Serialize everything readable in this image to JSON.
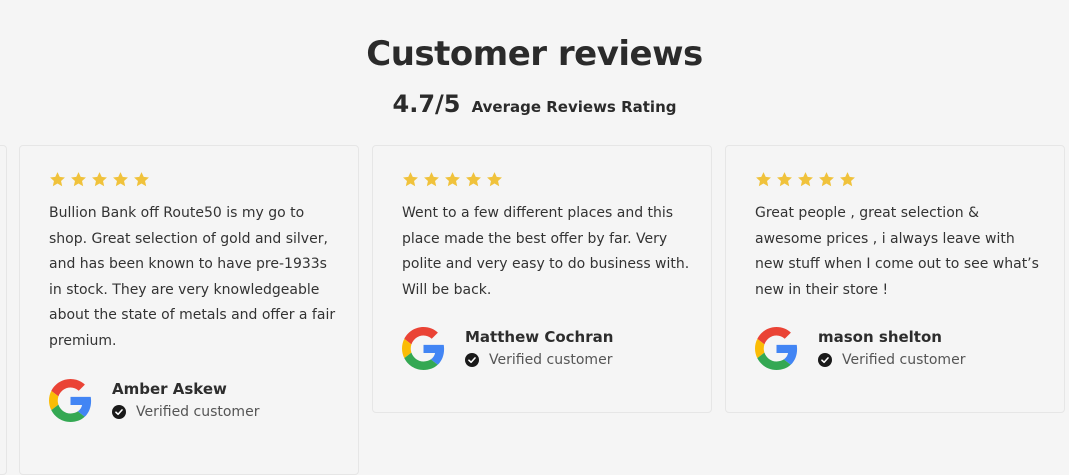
{
  "header": {
    "title": "Customer reviews",
    "rating_value": "4.7/5",
    "rating_label": "Average Reviews Rating"
  },
  "colors": {
    "star": "#f0c23b",
    "background": "#f5f5f5"
  },
  "reviews": [
    {
      "stars": 5,
      "text": "Bullion Bank off Route50 is my go to shop. Great selection of gold and silver, and has been known to have pre-1933s in stock. They are very knowledgeable about the state of metals and offer a fair premium.",
      "author": "Amber Askew",
      "verified_label": "Verified customer",
      "source_icon": "google-icon"
    },
    {
      "stars": 5,
      "text": "Went to a few different places and this place made the best offer by far. Very polite and very easy to do business with. Will be back.",
      "author": "Matthew Cochran",
      "verified_label": "Verified customer",
      "source_icon": "google-icon"
    },
    {
      "stars": 5,
      "text": "Great people , great selection & awesome prices , i always leave with new stuff when I come out to see what’s new in their store !",
      "author": "mason shelton",
      "verified_label": "Verified customer",
      "source_icon": "google-icon"
    }
  ]
}
